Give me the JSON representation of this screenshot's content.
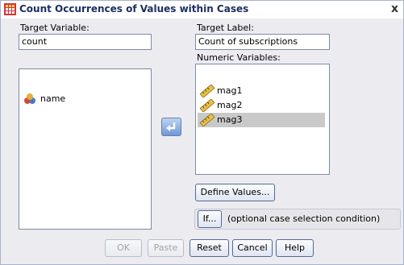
{
  "window": {
    "title": "Count Occurrences of Values within Cases",
    "close_glyph": "x"
  },
  "target_variable": {
    "label": "Target Variable:",
    "value": "count"
  },
  "target_label": {
    "label": "Target Label:",
    "value": "Count of subscriptions"
  },
  "source_list": {
    "items": [
      {
        "label": "name",
        "icon": "nominal-variable-icon"
      }
    ]
  },
  "numeric_variables": {
    "label": "Numeric Variables:",
    "items": [
      {
        "label": "mag1",
        "icon": "scale-variable-icon",
        "selected": false
      },
      {
        "label": "mag2",
        "icon": "scale-variable-icon",
        "selected": false
      },
      {
        "label": "mag3",
        "icon": "scale-variable-icon",
        "selected": true
      }
    ]
  },
  "buttons": {
    "define_values": "Define Values...",
    "if": "If...",
    "if_description": "(optional case selection condition)",
    "ok": "OK",
    "paste": "Paste",
    "reset": "Reset",
    "cancel": "Cancel",
    "help": "Help"
  },
  "colors": {
    "title_text": "#1c2e63",
    "dialog_bg": "#ecebf0",
    "selection": "#c9c9c9",
    "arrow_button": "#6f98d8"
  }
}
